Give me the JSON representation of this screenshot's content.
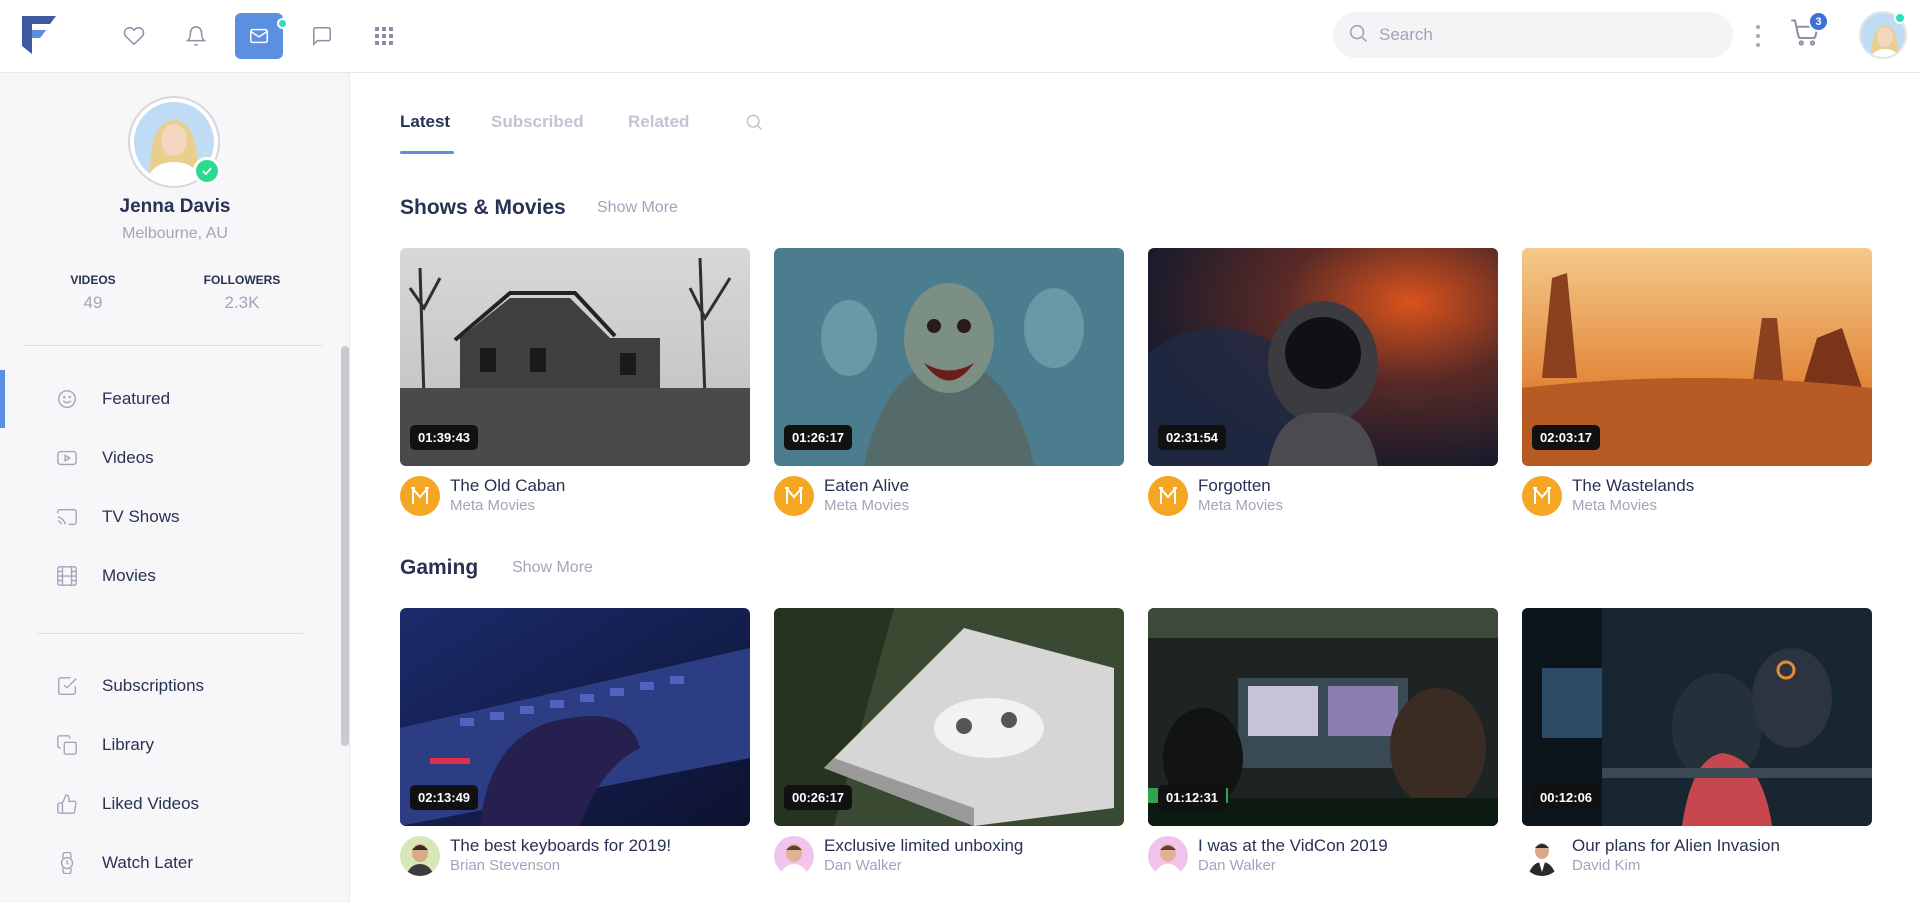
{
  "topbar": {
    "search_placeholder": "Search",
    "cart_count": "3",
    "icons": [
      "heart-icon",
      "bell-icon",
      "mail-icon",
      "chat-icon",
      "apps-grid-icon"
    ]
  },
  "profile": {
    "name": "Jenna Davis",
    "location": "Melbourne, AU",
    "stats": [
      {
        "label": "VIDEOS",
        "value": "49"
      },
      {
        "label": "FOLLOWERS",
        "value": "2.3K"
      }
    ]
  },
  "sidebar": {
    "primary": [
      {
        "label": "Featured",
        "icon": "smile-icon",
        "active": true
      },
      {
        "label": "Videos",
        "icon": "play-icon"
      },
      {
        "label": "TV Shows",
        "icon": "cast-icon"
      },
      {
        "label": "Movies",
        "icon": "film-icon"
      }
    ],
    "secondary": [
      {
        "label": "Subscriptions",
        "icon": "check-square-icon"
      },
      {
        "label": "Library",
        "icon": "copy-icon"
      },
      {
        "label": "Liked Videos",
        "icon": "thumbs-up-icon"
      },
      {
        "label": "Watch Later",
        "icon": "watch-icon"
      }
    ]
  },
  "tabs": [
    "Latest",
    "Subscribed",
    "Related"
  ],
  "sections": [
    {
      "title": "Shows & Movies",
      "show_more": "Show More",
      "videos": [
        {
          "title": "The Old Caban",
          "channel": "Meta Movies",
          "duration": "01:39:43"
        },
        {
          "title": "Eaten Alive",
          "channel": "Meta Movies",
          "duration": "01:26:17"
        },
        {
          "title": "Forgotten",
          "channel": "Meta Movies",
          "duration": "02:31:54"
        },
        {
          "title": "The Wastelands",
          "channel": "Meta Movies",
          "duration": "02:03:17"
        }
      ]
    },
    {
      "title": "Gaming",
      "show_more": "Show More",
      "videos": [
        {
          "title": "The best keyboards for 2019!",
          "channel": "Brian Stevenson",
          "duration": "02:13:49"
        },
        {
          "title": "Exclusive limited unboxing",
          "channel": "Dan Walker",
          "duration": "00:26:17"
        },
        {
          "title": "I was at the VidCon 2019",
          "channel": "Dan Walker",
          "duration": "01:12:31"
        },
        {
          "title": "Our plans for Alien Invasion",
          "channel": "David Kim",
          "duration": "00:12:06"
        }
      ]
    }
  ],
  "colors": {
    "accent": "#5b8fe0",
    "online": "#27ddc2",
    "verified": "#2bd98f",
    "channel_logo": "#f5a623"
  }
}
